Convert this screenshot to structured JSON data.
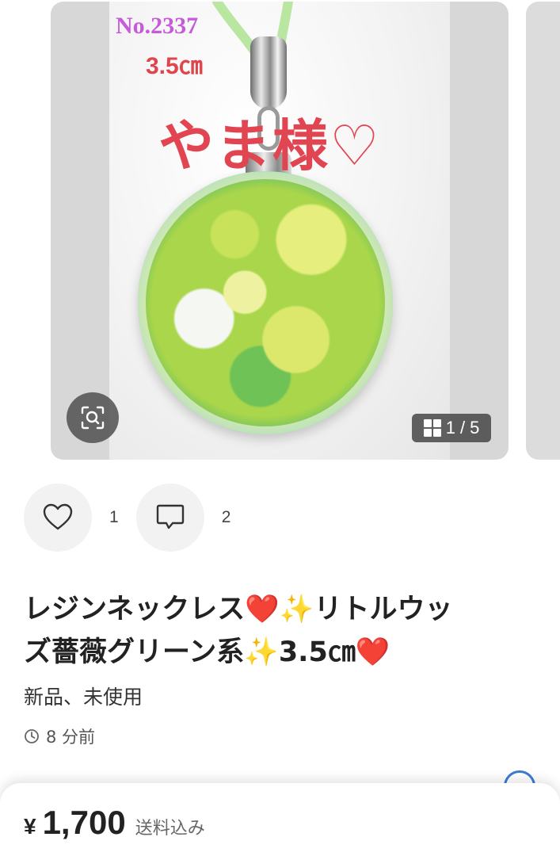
{
  "image_overlay": {
    "item_number": "No.2337",
    "size_label": "3.5㎝",
    "buyer_label": "やま様♡"
  },
  "gallery": {
    "current": "1",
    "separator": "/",
    "total": "5"
  },
  "icons": {
    "zoom": "zoom-scan-icon",
    "gallery": "grid-icon",
    "like": "heart-icon",
    "comment": "comment-icon",
    "time": "clock-icon"
  },
  "actions": {
    "like_count": "1",
    "comment_count": "2"
  },
  "item": {
    "title_line1": "レジンネックレス❤️✨リトルウッ",
    "title_line2": "ズ薔薇グリーン系✨3.5㎝❤️",
    "condition": "新品、未使用",
    "posted": "8 分前"
  },
  "price": {
    "currency": "¥",
    "amount": "1,700",
    "shipping": "送料込み"
  },
  "colors": {
    "title_text": "#222222",
    "overlay_purple": "#c65bd9",
    "overlay_red": "#e24552",
    "action_bg": "#f2f2f2",
    "info_blue": "#3a7bd5"
  }
}
